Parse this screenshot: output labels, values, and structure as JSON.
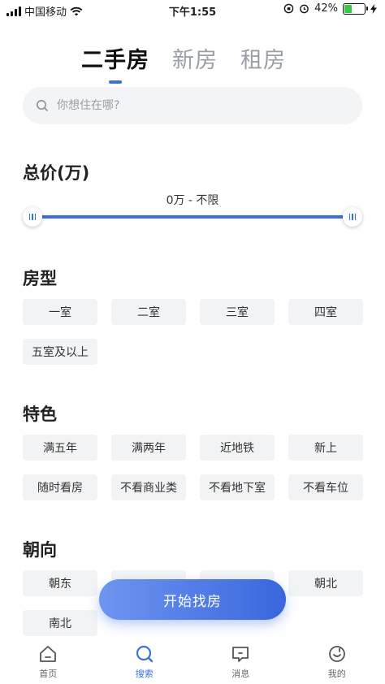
{
  "status_bar": {
    "carrier": "中国移动",
    "time": "下午1:55",
    "battery_percent": "42%",
    "battery_level": 0.42
  },
  "tabs": [
    {
      "label": "二手房",
      "active": true
    },
    {
      "label": "新房",
      "active": false
    },
    {
      "label": "租房",
      "active": false
    }
  ],
  "search": {
    "placeholder": "你想住在哪?"
  },
  "price": {
    "title": "总价(万)",
    "range_text": "0万 - 不限"
  },
  "room_type": {
    "title": "房型",
    "options": [
      "一室",
      "二室",
      "三室",
      "四室",
      "五室及以上"
    ]
  },
  "features": {
    "title": "特色",
    "options": [
      "满五年",
      "满两年",
      "近地铁",
      "新上",
      "随时看房",
      "不看商业类",
      "不看地下室",
      "不看车位"
    ]
  },
  "orientation": {
    "title": "朝向",
    "options": [
      "朝东",
      "",
      "",
      "朝北",
      "南北"
    ]
  },
  "cta": {
    "label": "开始找房"
  },
  "nav": [
    {
      "label": "首页",
      "icon": "home-icon",
      "active": false
    },
    {
      "label": "搜索",
      "icon": "search-icon",
      "active": true
    },
    {
      "label": "消息",
      "icon": "message-icon",
      "active": false
    },
    {
      "label": "我的",
      "icon": "profile-icon",
      "active": false
    }
  ],
  "colors": {
    "accent": "#3b6fe0",
    "chip_bg": "#f2f3f5",
    "battery_green": "#3ac64a"
  }
}
